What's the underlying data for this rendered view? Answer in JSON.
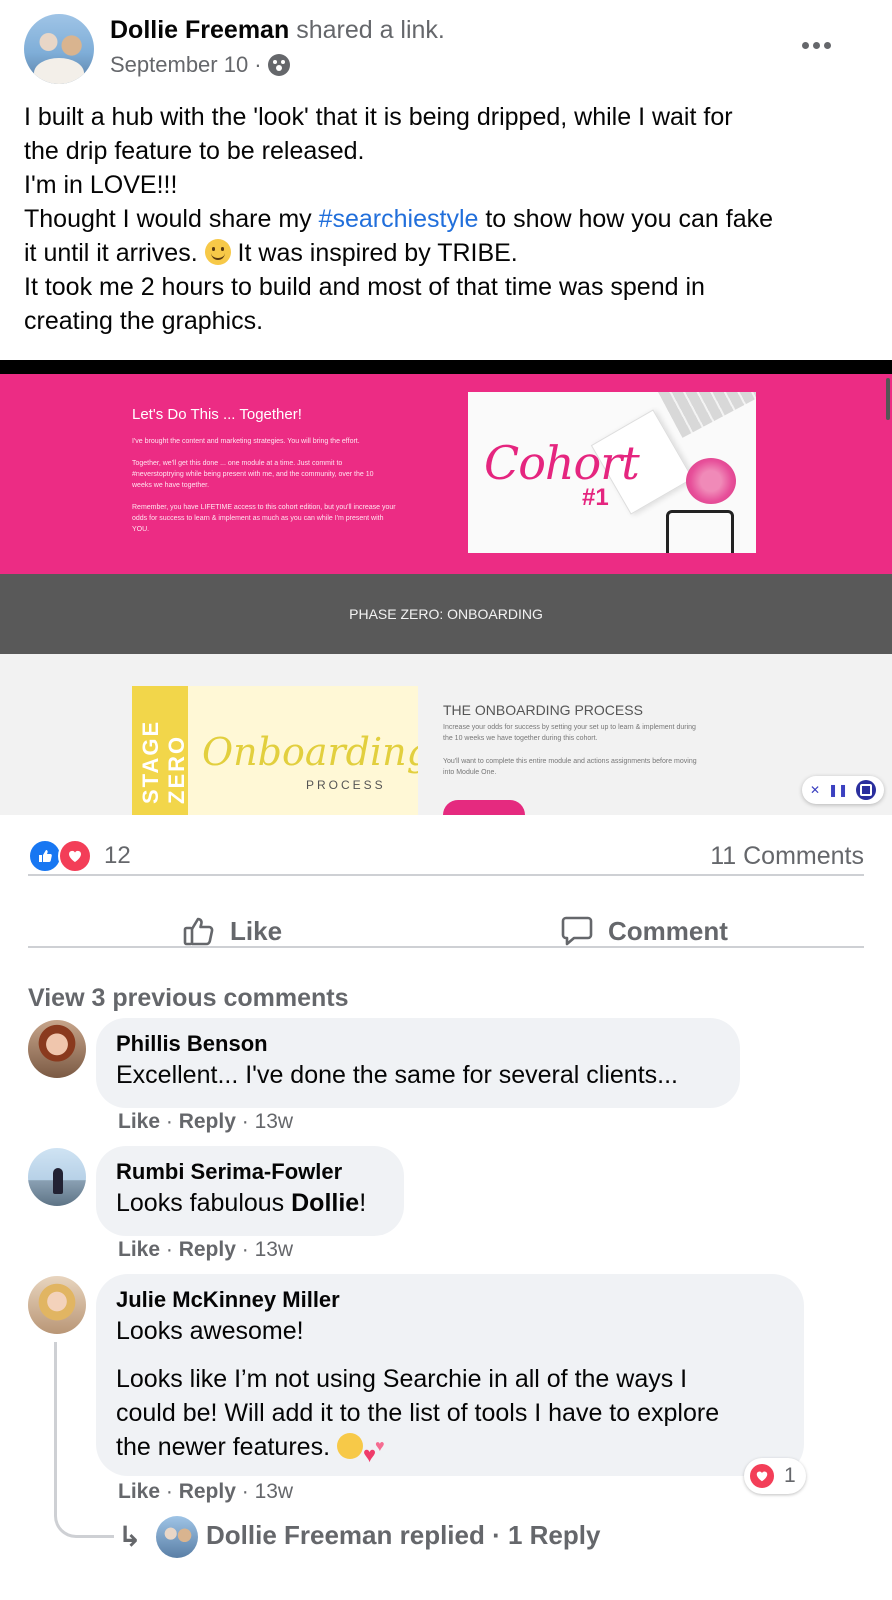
{
  "post": {
    "author": "Dollie Freeman",
    "action": "shared a link.",
    "date": "September 10",
    "meta_separator": "·",
    "more_icon": "more-horizontal-icon",
    "audience_icon": "globe-icon",
    "text_lines": [
      "I built a hub with the 'look' that it is being dripped, while I wait for",
      "the drip feature to be released.",
      "I'm in LOVE!!!"
    ],
    "line4_before": "Thought I would share my ",
    "hashtag": "#searchiestyle",
    "line4_after": " to show how you can fake",
    "line5_before": "it until it arrives. ",
    "line5_after": " It was inspired by TRIBE.",
    "text_lines_end": [
      "It took me 2 hours to build and most of that time was spend in",
      "creating the graphics."
    ]
  },
  "media": {
    "hero_title": "Let's Do This ... Together!",
    "hero_lines": [
      "I've brought the content and marketing strategies. You will bring the effort.",
      "Together, we'll get this done ... one module at a time. Just commit to",
      "#neverstoptrying while being present with me, and the community, over the 10",
      "weeks we have together.",
      "Remember, you have LIFETIME access to this cohort edition, but you'll increase your",
      "odds for success to learn & implement as much as you can while I'm present with",
      "YOU."
    ],
    "cohort_script": "Cohort",
    "cohort_num": "#1",
    "phase_label": "PHASE ZERO: ONBOARDING",
    "stage_text_1": "STAGE",
    "stage_text_2": "ZERO",
    "onboarding_script": "Onboarding",
    "onboarding_process": "PROCESS",
    "onboarding_title": "THE ONBOARDING PROCESS",
    "onboarding_lines": [
      "Increase your odds for success by setting your set up to learn & implement during",
      "the 10 weeks we have together during this cohort.",
      "You'll want to complete this entire module and actions assignments before moving",
      "into Module One."
    ],
    "player_close": "✕",
    "player_pause": "❚❚"
  },
  "stats": {
    "reaction_count": "12",
    "comments_count": "11 Comments",
    "reactions": [
      "like-icon",
      "love-icon"
    ]
  },
  "actions": {
    "like_label": "Like",
    "comment_label": "Comment"
  },
  "view_previous": "View 3 previous comments",
  "comments": [
    {
      "name": "Phillis Benson",
      "text": "Excellent... I've done the same for several clients...",
      "like": "Like",
      "reply": "Reply",
      "time": "13w"
    },
    {
      "name": "Rumbi Serima-Fowler",
      "text_before": "Looks fabulous ",
      "text_bold": "Dollie",
      "text_after": "!",
      "like": "Like",
      "reply": "Reply",
      "time": "13w"
    },
    {
      "name": "Julie McKinney Miller",
      "text_1": "Looks awesome!",
      "text_2_lines": [
        "Looks like I’m not using Searchie in all of the ways I",
        "could be! Will add it to the list of tools I have to explore",
        "the newer features. "
      ],
      "like": "Like",
      "reply": "Reply",
      "time": "13w",
      "reaction_count": "1"
    }
  ],
  "reply_summary": {
    "arrow": "↳",
    "text": "Dollie Freeman replied · 1 Reply"
  },
  "colors": {
    "hashtag": "#216fdb",
    "brand_pink": "#ec2c84",
    "like_blue": "#1877f2",
    "love_red": "#f33e58",
    "muted": "#65676b",
    "bubble": "#f0f2f5"
  }
}
